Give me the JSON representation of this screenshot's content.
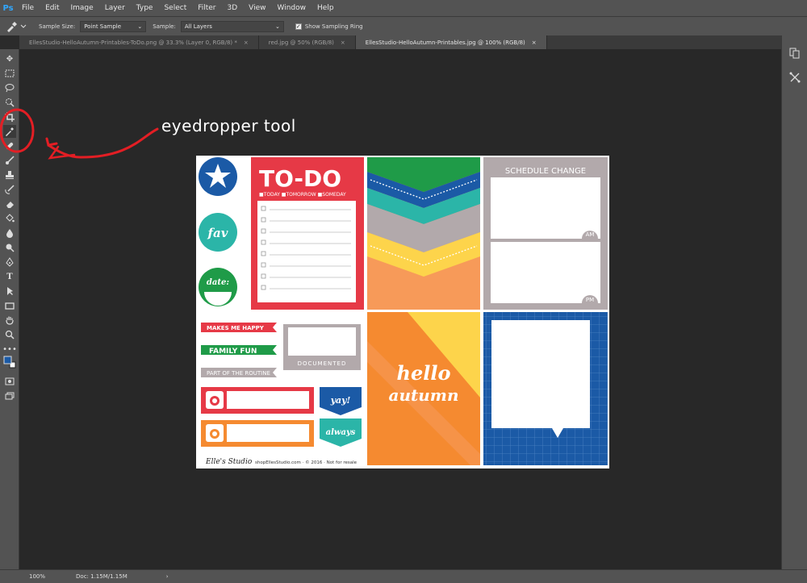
{
  "menubar": {
    "logo": "Ps",
    "items": [
      "File",
      "Edit",
      "Image",
      "Layer",
      "Type",
      "Select",
      "Filter",
      "3D",
      "View",
      "Window",
      "Help"
    ]
  },
  "options": {
    "sample_size_label": "Sample Size:",
    "sample_size_value": "Point Sample",
    "sample_label": "Sample:",
    "sample_value": "All Layers",
    "sampling_ring_label": "Show Sampling Ring",
    "sampling_ring_checked": true
  },
  "tabs": [
    {
      "label": "EllesStudio-HelloAutumn-Printables-ToDo.png @ 33.3% (Layer 0, RGB/8) *",
      "active": false
    },
    {
      "label": "red.jpg @ 50% (RGB/8)",
      "active": false
    },
    {
      "label": "EllesStudio-HelloAutumn-Printables.jpg @ 100% (RGB/8)",
      "active": true
    }
  ],
  "annotation": {
    "text": "eyedropper tool",
    "color": "#e31e24"
  },
  "artwork": {
    "todo_title": "TO-DO",
    "todo_subtitle": "■TODAY ■TOMORROW ■SOMEDAY",
    "fav": "fav",
    "date": "date:",
    "schedule": "SCHEDULE CHANGE",
    "am": "AM",
    "pm": "PM",
    "makes_me_happy": "MAKES ME HAPPY",
    "family_fun": "FAMILY FUN",
    "part_of_routine": "PART OF THE ROUTINE",
    "documented": "DOCUMENTED",
    "yay": "yay!",
    "always": "always",
    "hello": "hello",
    "autumn": "autumn",
    "signature": "Elle's Studio",
    "footer": "shopEllesStudio.com · © 2016 · Not for resale"
  },
  "status": {
    "zoom": "100%",
    "doc": "Doc: 1.15M/1.15M"
  },
  "colors": {
    "red": "#e63946",
    "blue": "#1b5aa6",
    "green": "#1f9b48",
    "teal": "#2bb5a8",
    "orange": "#f58a30",
    "yellow": "#fdd44b",
    "gray": "#b2a9ab",
    "annotation": "#e31e24"
  }
}
